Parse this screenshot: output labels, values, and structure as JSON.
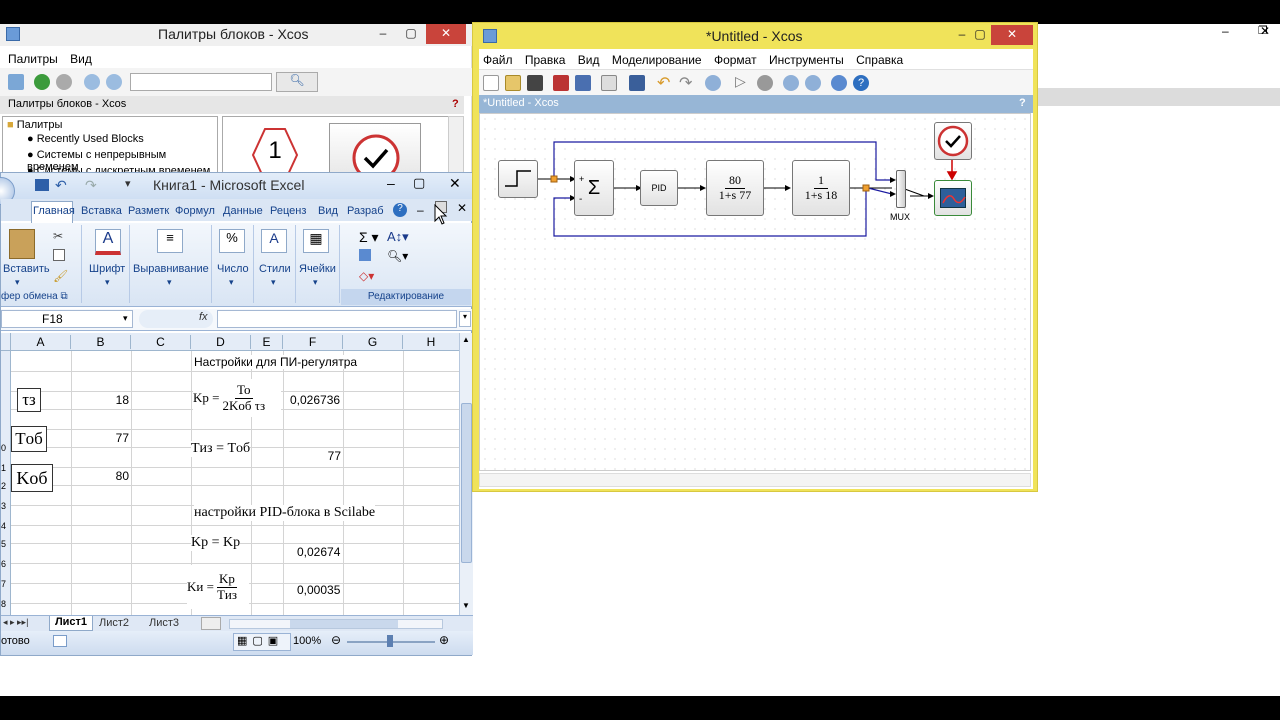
{
  "palette_window": {
    "title": "Палитры блоков - Xcos",
    "menu": [
      "Палитры",
      "Вид"
    ],
    "panel_title": "Палитры блоков - Xcos",
    "tree": [
      "Палитры",
      "Recently Used Blocks",
      "Системы с непрерывным временем",
      "Системы с дискретным временем"
    ],
    "block_label": "1"
  },
  "excel": {
    "title": "Книга1 - Microsoft Excel",
    "tabs": [
      "Главная",
      "Вставка",
      "Разметк",
      "Формул",
      "Данные",
      "Реценз",
      "Вид",
      "Разраб"
    ],
    "groups": {
      "paste": "Вставить",
      "font": "Шрифт",
      "align": "Выравнивание",
      "number": "Число",
      "styles": "Стили",
      "cells": "Ячейки",
      "clipboard": "фер обмена",
      "editing": "Редактирование",
      "number_icon": "%"
    },
    "name_box": "F18",
    "fx": "fx",
    "columns": [
      "A",
      "B",
      "C",
      "D",
      "E",
      "F",
      "G",
      "H"
    ],
    "row_numbers": [
      "0",
      "1",
      "2",
      "3",
      "4",
      "5",
      "6",
      "7",
      "8"
    ],
    "heading_pi": "Настройки для ПИ-регулятра",
    "tau_label": "τз",
    "T_label": "Tоб",
    "K_label": "Kоб",
    "val_tau": "18",
    "val_T": "77",
    "val_K": "80",
    "kp_lhs": "Kр =",
    "kp_num": "To",
    "kp_den": "2Kоб τз",
    "kp_val": "0,026736",
    "tiz_formula": "Tиз = Tоб",
    "tiz_val": "77",
    "heading_pid": "настройки PID-блока в Scilabe",
    "kp2_formula": "Kр = Kр",
    "kp2_val": "0,02674",
    "ki_lhs": "Kи =",
    "ki_num": "Kр",
    "ki_den": "Tиз",
    "ki_val": "0,00035",
    "sheets": [
      "Лист1",
      "Лист2",
      "Лист3"
    ],
    "status": "отово",
    "zoom": "100%"
  },
  "xcos": {
    "title": "*Untitled - Xcos",
    "menu": [
      "Файл",
      "Правка",
      "Вид",
      "Моделирование",
      "Формат",
      "Инструменты",
      "Справка"
    ],
    "panel_title": "*Untitled - Xcos",
    "help": "?",
    "blocks": {
      "sum": "Σ",
      "sum_plus": "+",
      "sum_minus": "-",
      "pid": "PID",
      "tf1_num": "80",
      "tf1_den": "1+s 77",
      "tf2_num": "1",
      "tf2_den": "1+s 18",
      "mux": "MUX"
    }
  }
}
